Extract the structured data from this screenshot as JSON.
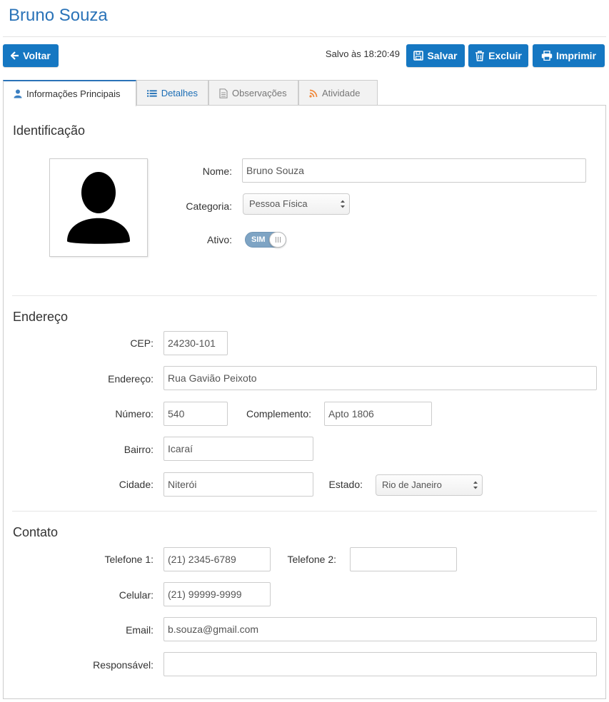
{
  "header": {
    "title": "Bruno Souza"
  },
  "toolbar": {
    "back_label": "Voltar",
    "saved_status": "Salvo às 18:20:49",
    "save_label": "Salvar",
    "delete_label": "Excluir",
    "print_label": "Imprimir"
  },
  "tabs": [
    {
      "label": "Informações Principais",
      "icon": "user-icon",
      "active": true
    },
    {
      "label": "Detalhes",
      "icon": "list-icon",
      "active": false
    },
    {
      "label": "Observações",
      "icon": "document-icon",
      "active": false
    },
    {
      "label": "Atividade",
      "icon": "rss-icon",
      "active": false
    }
  ],
  "identificacao": {
    "section_title": "Identificação",
    "nome_label": "Nome:",
    "nome_value": "Bruno Souza",
    "categoria_label": "Categoria:",
    "categoria_value": "Pessoa Física",
    "ativo_label": "Ativo:",
    "ativo_value": "SIM"
  },
  "endereco": {
    "section_title": "Endereço",
    "cep_label": "CEP:",
    "cep_value": "24230-101",
    "endereco_label": "Endereço:",
    "endereco_value": "Rua Gavião Peixoto",
    "numero_label": "Número:",
    "numero_value": "540",
    "complemento_label": "Complemento:",
    "complemento_value": "Apto 1806",
    "bairro_label": "Bairro:",
    "bairro_value": "Icaraí",
    "cidade_label": "Cidade:",
    "cidade_value": "Niterói",
    "estado_label": "Estado:",
    "estado_value": "Rio de Janeiro"
  },
  "contato": {
    "section_title": "Contato",
    "telefone1_label": "Telefone 1:",
    "telefone1_value": "(21) 2345-6789",
    "telefone2_label": "Telefone 2:",
    "telefone2_value": "",
    "celular_label": "Celular:",
    "celular_value": "(21) 99999-9999",
    "email_label": "Email:",
    "email_value": "b.souza@gmail.com",
    "responsavel_label": "Responsável:",
    "responsavel_value": ""
  },
  "colors": {
    "primary": "#1577c2",
    "title": "#2a73b8",
    "toggle_on": "#7ea4c4",
    "rss": "#f0883a"
  }
}
